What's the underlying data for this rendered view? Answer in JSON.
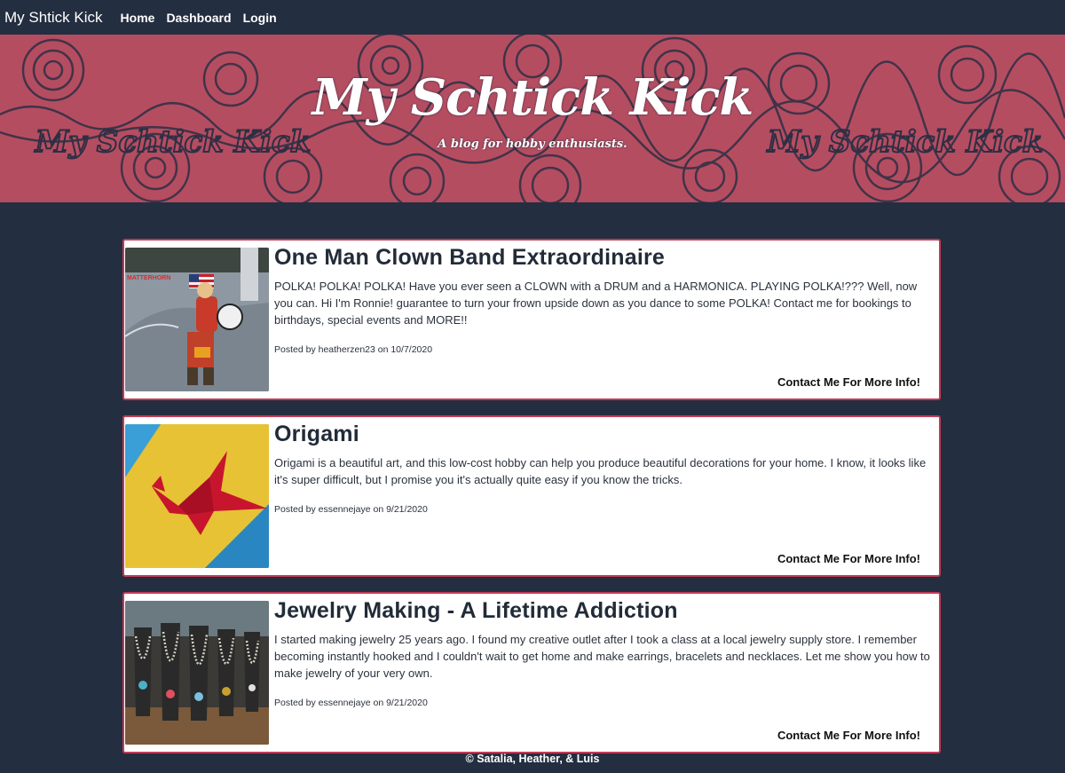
{
  "nav": {
    "brand": "My Shtick Kick",
    "links": [
      "Home",
      "Dashboard",
      "Login"
    ]
  },
  "hero": {
    "title": "My Schtick Kick",
    "tagline": "A blog for hobby enthusiasts.",
    "watermark_text": "My Schtick Kick"
  },
  "posts": [
    {
      "title": "One Man Clown Band Extraordinaire",
      "body": "POLKA! POLKA! POLKA! Have you ever seen a CLOWN with a DRUM and a HARMONICA. PLAYING POLKA!??? Well, now you can. Hi I'm Ronnie! guarantee to turn your frown upside down as you dance to some POLKA! Contact me for bookings to birthdays, special events and MORE!!",
      "meta": "Posted by heatherzen23 on 10/7/2020",
      "cta": "Contact Me For More Info!",
      "image_sign": "MATTERHORN"
    },
    {
      "title": "Origami",
      "body": "Origami is a beautiful art, and this low-cost hobby can help you produce beautiful decorations for your home. I know, it looks like it's super difficult, but I promise you it's actually quite easy if you know the tricks.",
      "meta": "Posted by essennejaye on 9/21/2020",
      "cta": "Contact Me For More Info!"
    },
    {
      "title": "Jewelry Making - A Lifetime Addiction",
      "body": "I started making jewelry 25 years ago. I found my creative outlet after I took a class at a local jewelry supply store. I remember becoming instantly hooked and I couldn't wait to get home and make earrings, bracelets and necklaces. Let me show you how to make jewelry of your very own.",
      "meta": "Posted by essennejaye on 9/21/2020",
      "cta": "Contact Me For More Info!"
    }
  ],
  "footer": "© Satalia, Heather, & Luis",
  "colors": {
    "background": "#232e40",
    "hero": "#b54d61",
    "accent_border": "#c23b56",
    "card": "#ffffff"
  }
}
